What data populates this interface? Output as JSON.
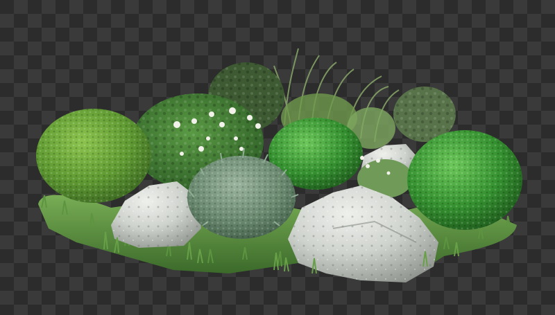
{
  "image": {
    "background": "transparency-checkerboard",
    "subject": "garden-shrub-and-rock-cluster"
  },
  "colors": {
    "checker_dark": "#2c2c2c",
    "checker_light": "#3a3a3a",
    "grass_dark": "#3f6b2e",
    "grass_light": "#6fa34a",
    "boxwood_dark": "#2f7d2c",
    "boxwood_light": "#5cb84a",
    "lime_bush": "#6aa83a",
    "flower_bush": "#3e7a32",
    "silver_shrub": "#6d8a72",
    "rock_light": "#d9dcd8",
    "rock_shadow": "#9aa09a",
    "flower_white": "#f2f2ea",
    "ornamental_grass": "#88a86a"
  }
}
